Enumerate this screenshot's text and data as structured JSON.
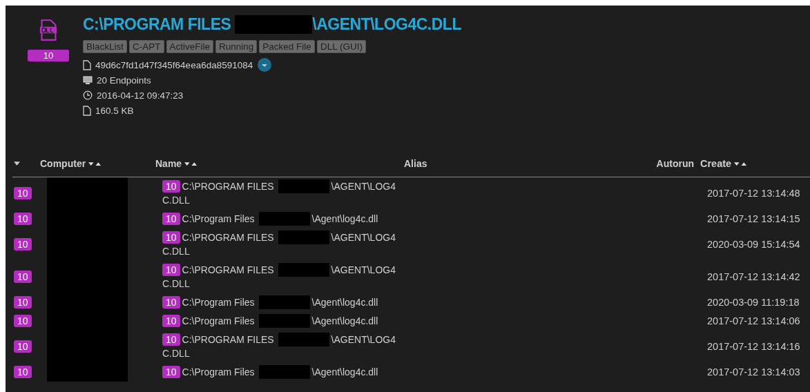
{
  "file": {
    "badge": "10",
    "title_before": "C:\\PROGRAM FILES",
    "title_after": "\\AGENT\\LOG4C.DLL",
    "tags": [
      "BlackList",
      "C-APT",
      "ActiveFile",
      "Running",
      "Packed File",
      "DLL (GUI)"
    ],
    "details": [
      {
        "kind": "hash",
        "text": "49d6c7fd1d47f345f64eea6da8591084"
      },
      {
        "kind": "endpoints",
        "text": "20 Endpoints"
      },
      {
        "kind": "time",
        "text": "2016-04-12 09:47:23"
      },
      {
        "kind": "size",
        "text": "160.5 KB"
      }
    ]
  },
  "table": {
    "columns": [
      {
        "label": "Computer",
        "sortable": true
      },
      {
        "label": "Name",
        "sortable": true
      },
      {
        "label": "Alias",
        "sortable": false
      },
      {
        "label": "Autorun",
        "sortable": false
      },
      {
        "label": "Create",
        "sortable": true
      }
    ],
    "rows": [
      {
        "badge": "10",
        "name_badge": "10",
        "name_before": "C:\\PROGRAM FILES",
        "name_after": "\\AGENT\\LOG4",
        "name_wrap": "C.DLL",
        "create": "2017-07-12 13:14:48"
      },
      {
        "badge": "10",
        "name_badge": "10",
        "name_before": "C:\\Program Files",
        "name_after": "\\Agent\\log4c.dll",
        "create": "2017-07-12 13:14:15"
      },
      {
        "badge": "10",
        "name_badge": "10",
        "name_before": "C:\\PROGRAM FILES",
        "name_after": "\\AGENT\\LOG4",
        "name_wrap": "C.DLL",
        "create": "2020-03-09 15:14:54"
      },
      {
        "badge": "10",
        "name_badge": "10",
        "name_before": "C:\\PROGRAM FILES",
        "name_after": "\\AGENT\\LOG4",
        "name_wrap": "C.DLL",
        "create": "2017-07-12 13:14:42"
      },
      {
        "badge": "10",
        "name_badge": "10",
        "name_before": "C:\\Program Files",
        "name_after": "\\Agent\\log4c.dll",
        "create": "2020-03-09 11:19:18"
      },
      {
        "badge": "10",
        "name_badge": "10",
        "name_before": "C:\\Program Files",
        "name_after": "\\Agent\\log4c.dll",
        "create": "2017-07-12 13:14:06"
      },
      {
        "badge": "10",
        "name_badge": "10",
        "name_before": "C:\\PROGRAM FILES",
        "name_after": "\\AGENT\\LOG4",
        "name_wrap": "C.DLL",
        "create": "2017-07-12 13:14:16"
      },
      {
        "badge": "10",
        "name_badge": "10",
        "name_before": "C:\\Program Files",
        "name_after": "\\Agent\\log4c.dll",
        "create": "2017-07-12 13:14:03"
      }
    ]
  }
}
